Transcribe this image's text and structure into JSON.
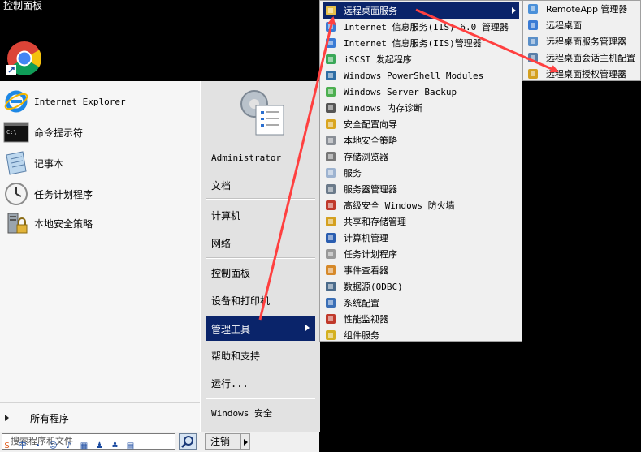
{
  "desktop": {
    "title": "控制面板"
  },
  "start_menu": {
    "pinned": [
      {
        "label": "Internet Explorer",
        "icon": "internet-explorer-icon"
      },
      {
        "label": "命令提示符",
        "icon": "command-prompt-icon"
      },
      {
        "label": "记事本",
        "icon": "notepad-icon"
      },
      {
        "label": "任务计划程序",
        "icon": "task-scheduler-icon"
      },
      {
        "label": "本地安全策略",
        "icon": "local-security-policy-icon"
      }
    ],
    "all_programs_label": "所有程序",
    "search_placeholder": "搜索程序和文件",
    "right": {
      "user": "Administrator",
      "documents": "文档",
      "computer": "计算机",
      "network": "网络",
      "control_panel": "控制面板",
      "devices": "设备和打印机",
      "admin_tools": "管理工具",
      "help": "帮助和支持",
      "run": "运行...",
      "windows_security": "Windows 安全"
    },
    "shutdown_label": "注销"
  },
  "admin_tools_menu": [
    {
      "label": "远程桌面服务",
      "icon": "folder-icon",
      "has_submenu": true
    },
    {
      "label": "Internet 信息服务(IIS) 6.0 管理器",
      "icon": "iis-icon"
    },
    {
      "label": "Internet 信息服务(IIS)管理器",
      "icon": "iis-icon"
    },
    {
      "label": "iSCSI 发起程序",
      "icon": "iscsi-icon"
    },
    {
      "label": "Windows PowerShell Modules",
      "icon": "powershell-icon"
    },
    {
      "label": "Windows Server Backup",
      "icon": "backup-icon"
    },
    {
      "label": "Windows 内存诊断",
      "icon": "memory-icon"
    },
    {
      "label": "安全配置向导",
      "icon": "security-wizard-icon"
    },
    {
      "label": "本地安全策略",
      "icon": "local-security-policy-icon"
    },
    {
      "label": "存储浏览器",
      "icon": "storage-icon"
    },
    {
      "label": "服务",
      "icon": "services-icon"
    },
    {
      "label": "服务器管理器",
      "icon": "server-manager-icon"
    },
    {
      "label": "高级安全 Windows 防火墙",
      "icon": "firewall-icon"
    },
    {
      "label": "共享和存储管理",
      "icon": "share-icon"
    },
    {
      "label": "计算机管理",
      "icon": "computer-management-icon"
    },
    {
      "label": "任务计划程序",
      "icon": "task-scheduler-icon"
    },
    {
      "label": "事件查看器",
      "icon": "event-viewer-icon"
    },
    {
      "label": "数据源(ODBC)",
      "icon": "odbc-icon"
    },
    {
      "label": "系统配置",
      "icon": "system-config-icon"
    },
    {
      "label": "性能监视器",
      "icon": "performance-icon"
    },
    {
      "label": "组件服务",
      "icon": "component-services-icon"
    }
  ],
  "rds_menu": [
    {
      "label": "RemoteApp 管理器",
      "icon": "remoteapp-icon"
    },
    {
      "label": "远程桌面",
      "icon": "remote-desktop-icon"
    },
    {
      "label": "远程桌面服务管理器",
      "icon": "rds-manager-icon"
    },
    {
      "label": "远程桌面会话主机配置",
      "icon": "rdsh-config-icon"
    },
    {
      "label": "远程桌面授权管理器",
      "icon": "licensing-icon"
    }
  ],
  "colors": {
    "highlight": "#0a246a",
    "annotation_arrow": "#ff4040"
  }
}
